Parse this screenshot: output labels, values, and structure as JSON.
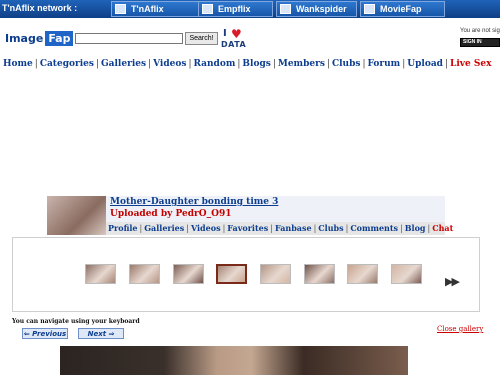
{
  "network": {
    "label": "T'nAflix network :",
    "sites": [
      {
        "name": "T'nAflix",
        "icon": "tnaflix-icon"
      },
      {
        "name": "Empflix",
        "icon": "empflix-icon"
      },
      {
        "name": "Wankspider",
        "icon": "wankspider-icon"
      },
      {
        "name": "MovieFap",
        "icon": "moviefap-icon"
      }
    ]
  },
  "header": {
    "logo_part1": "Image",
    "logo_part2": "Fap",
    "search_placeholder": "",
    "search_button": "Search!",
    "ad_logo_i": "I",
    "ad_logo_text": "DATA",
    "signin_note": "You are not sig",
    "signin_button": "SIGN IN"
  },
  "mainnav": {
    "items": [
      "Home",
      "Categories",
      "Galleries",
      "Videos",
      "Random",
      "Blogs",
      "Members",
      "Clubs",
      "Forum",
      "Upload",
      "Live Sex"
    ],
    "separator": "|"
  },
  "gallery": {
    "title": "Mother-Daughter bonding time 3",
    "uploader": "Uploaded by PedrO_O91",
    "nav": [
      "Profile",
      "Galleries",
      "Videos",
      "Favorites",
      "Fanbase",
      "Clubs",
      "Comments",
      "Blog",
      "Chat"
    ]
  },
  "thumbs": {
    "count": 8,
    "selected_index": 3,
    "next_glyph": "▶▶"
  },
  "keyboard": {
    "note": "You can navigate using your keyboard",
    "prev": "⇐ Previous",
    "next": "Next ⇒",
    "close": "Close gallery"
  },
  "colors": {
    "network_bar": "#1656a8",
    "nav_link": "#0c3d8e",
    "live_sex": "#cc0000",
    "uploader": "#c40000"
  }
}
